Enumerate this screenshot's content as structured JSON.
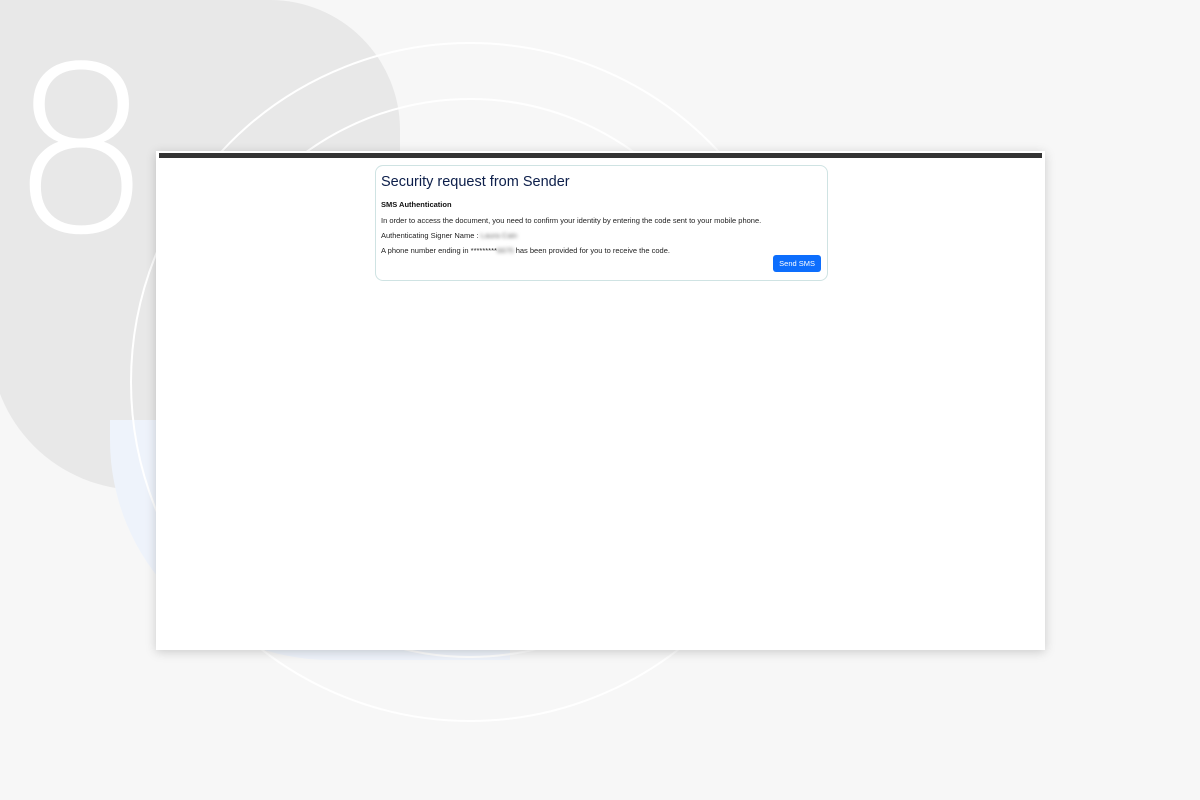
{
  "background": {
    "step_number": "8"
  },
  "card": {
    "title": "Security request from Sender",
    "subtitle": "SMS Authentication",
    "instruction": "In order to access the document, you need to confirm your identity by entering the code sent to your mobile phone.",
    "signer_label": "Authenticating Signer Name :",
    "signer_name": "Laura Cain",
    "phone_prefix": "A phone number ending in *********",
    "phone_suffix": "6675",
    "phone_tail": "has been provided for you to receive the code.",
    "button_label": "Send SMS"
  },
  "colors": {
    "title": "#0c1e4a",
    "button": "#0d6efd",
    "top_bar": "#333333"
  }
}
